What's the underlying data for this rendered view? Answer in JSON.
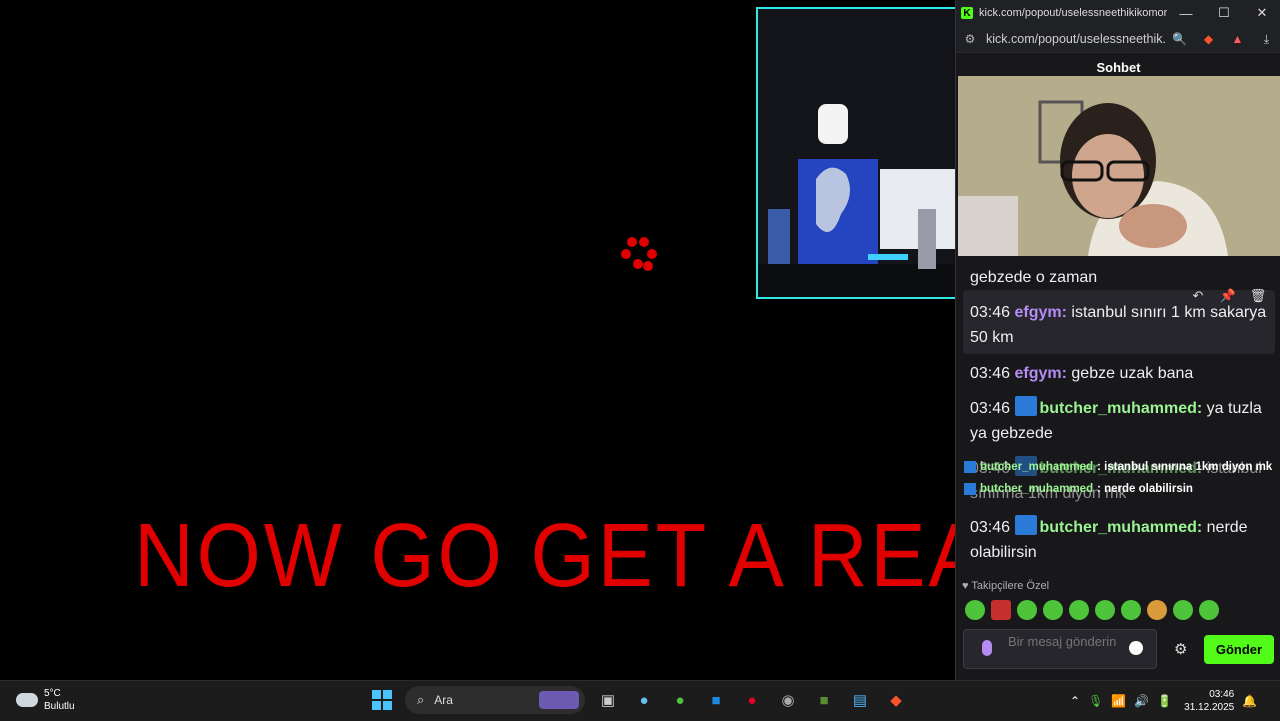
{
  "stream": {
    "overlay_text": "NOW GO GET A REAL"
  },
  "window": {
    "title": "kick.com/popout/uselessneethikikomori...",
    "url": "kick.com/popout/uselessneethik...",
    "controls": {
      "minimize": "—",
      "maximize": "☐",
      "close": "✕"
    }
  },
  "chat": {
    "header": "Sohbet",
    "messages": [
      {
        "time": "",
        "user": "",
        "text": "gebzede o zaman"
      },
      {
        "time": "03:46",
        "user": "efgym",
        "text": "istanbul sınırı 1 km sakarya 50 km"
      },
      {
        "time": "03:46",
        "user": "efgym",
        "text": "gebze uzak bana"
      },
      {
        "time": "03:46",
        "user": "butcher_muhammed",
        "text": "ya tuzla ya gebzede"
      },
      {
        "time": "03:46",
        "user": "butcher_muhammed",
        "text": "istanbul sınırına 1km diyon mk"
      },
      {
        "time": "03:46",
        "user": "butcher_muhammed",
        "text": "nerde olabilirsin"
      }
    ],
    "overlay_alerts": [
      {
        "user": "butcher_muhammed",
        "text": ": istanbul sınırına 1km diyon mk"
      },
      {
        "user": "butcher_muhammed",
        "text": ": nerde olabilirsin"
      }
    ],
    "followers_only": "Takipçilere Özel",
    "input_placeholder": "Bir mesaj gönderin",
    "send_label": "Gönder"
  },
  "taskbar": {
    "weather_temp": "5°C",
    "weather_desc": "Bulutlu",
    "search_label": "Ara",
    "time": "03:46",
    "date": "31.12.2025"
  },
  "colors": {
    "kick_green": "#53fc18",
    "user_purple": "#b48cf2",
    "user_green": "#9cf394",
    "overlay_red": "#e00000",
    "cam_border": "#2ee9e6"
  }
}
